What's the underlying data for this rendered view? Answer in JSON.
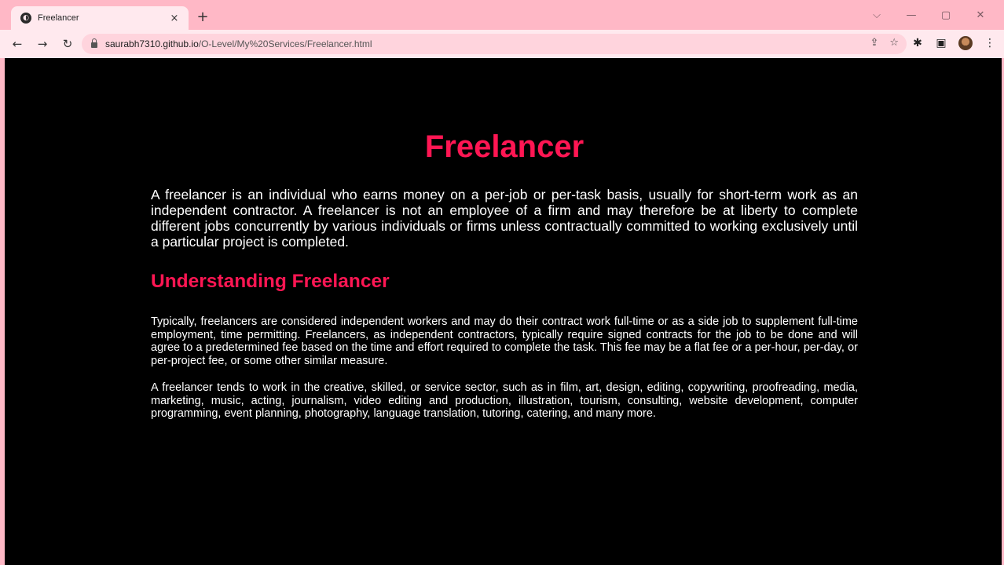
{
  "browser": {
    "tab_title": "Freelancer",
    "tab_close": "×",
    "new_tab": "+",
    "url_host": "saurabh7310.github.io",
    "url_path": "/O-Level/My%20Services/Freelancer.html",
    "window_controls": {
      "minimize": "—",
      "restore": "▢",
      "close": "✕",
      "tab_search": "⌵"
    },
    "nav": {
      "back": "←",
      "forward": "→",
      "reload": "↻"
    },
    "omni_icons": {
      "share": "⇪",
      "bookmark": "☆"
    },
    "toolbar_icons": {
      "extensions": "✱",
      "side_panel": "▣",
      "menu": "⋮"
    }
  },
  "page": {
    "title": "Freelancer",
    "intro": "A freelancer is an individual who earns money on a per-job or per-task basis, usually for short-term work as an independent contractor. A freelancer is not an employee of a firm and may therefore be at liberty to complete different jobs concurrently by various individuals or firms unless contractually committed to working exclusively until a particular project is completed.",
    "section_title": "Understanding Freelancer",
    "paragraphs": [
      "Typically, freelancers are considered independent workers and may do their contract work full-time or as a side job to supplement full-time employment, time permitting. Freelancers, as independent contractors, typically require signed contracts for the job to be done and will agree to a predetermined fee based on the time and effort required to complete the task. This fee may be a flat fee or a per-hour, per-day, or per-project fee, or some other similar measure.",
      "A freelancer tends to work in the creative, skilled, or service sector, such as in film, art, design, editing, copywriting, proofreading, media, marketing, music, acting, journalism, video editing and production, illustration, tourism, consulting, website development, computer programming, event planning, photography, language translation, tutoring, catering, and many more."
    ]
  },
  "colors": {
    "accent": "#ff1653",
    "background": "#000000",
    "chrome": "#ffb8c6"
  }
}
